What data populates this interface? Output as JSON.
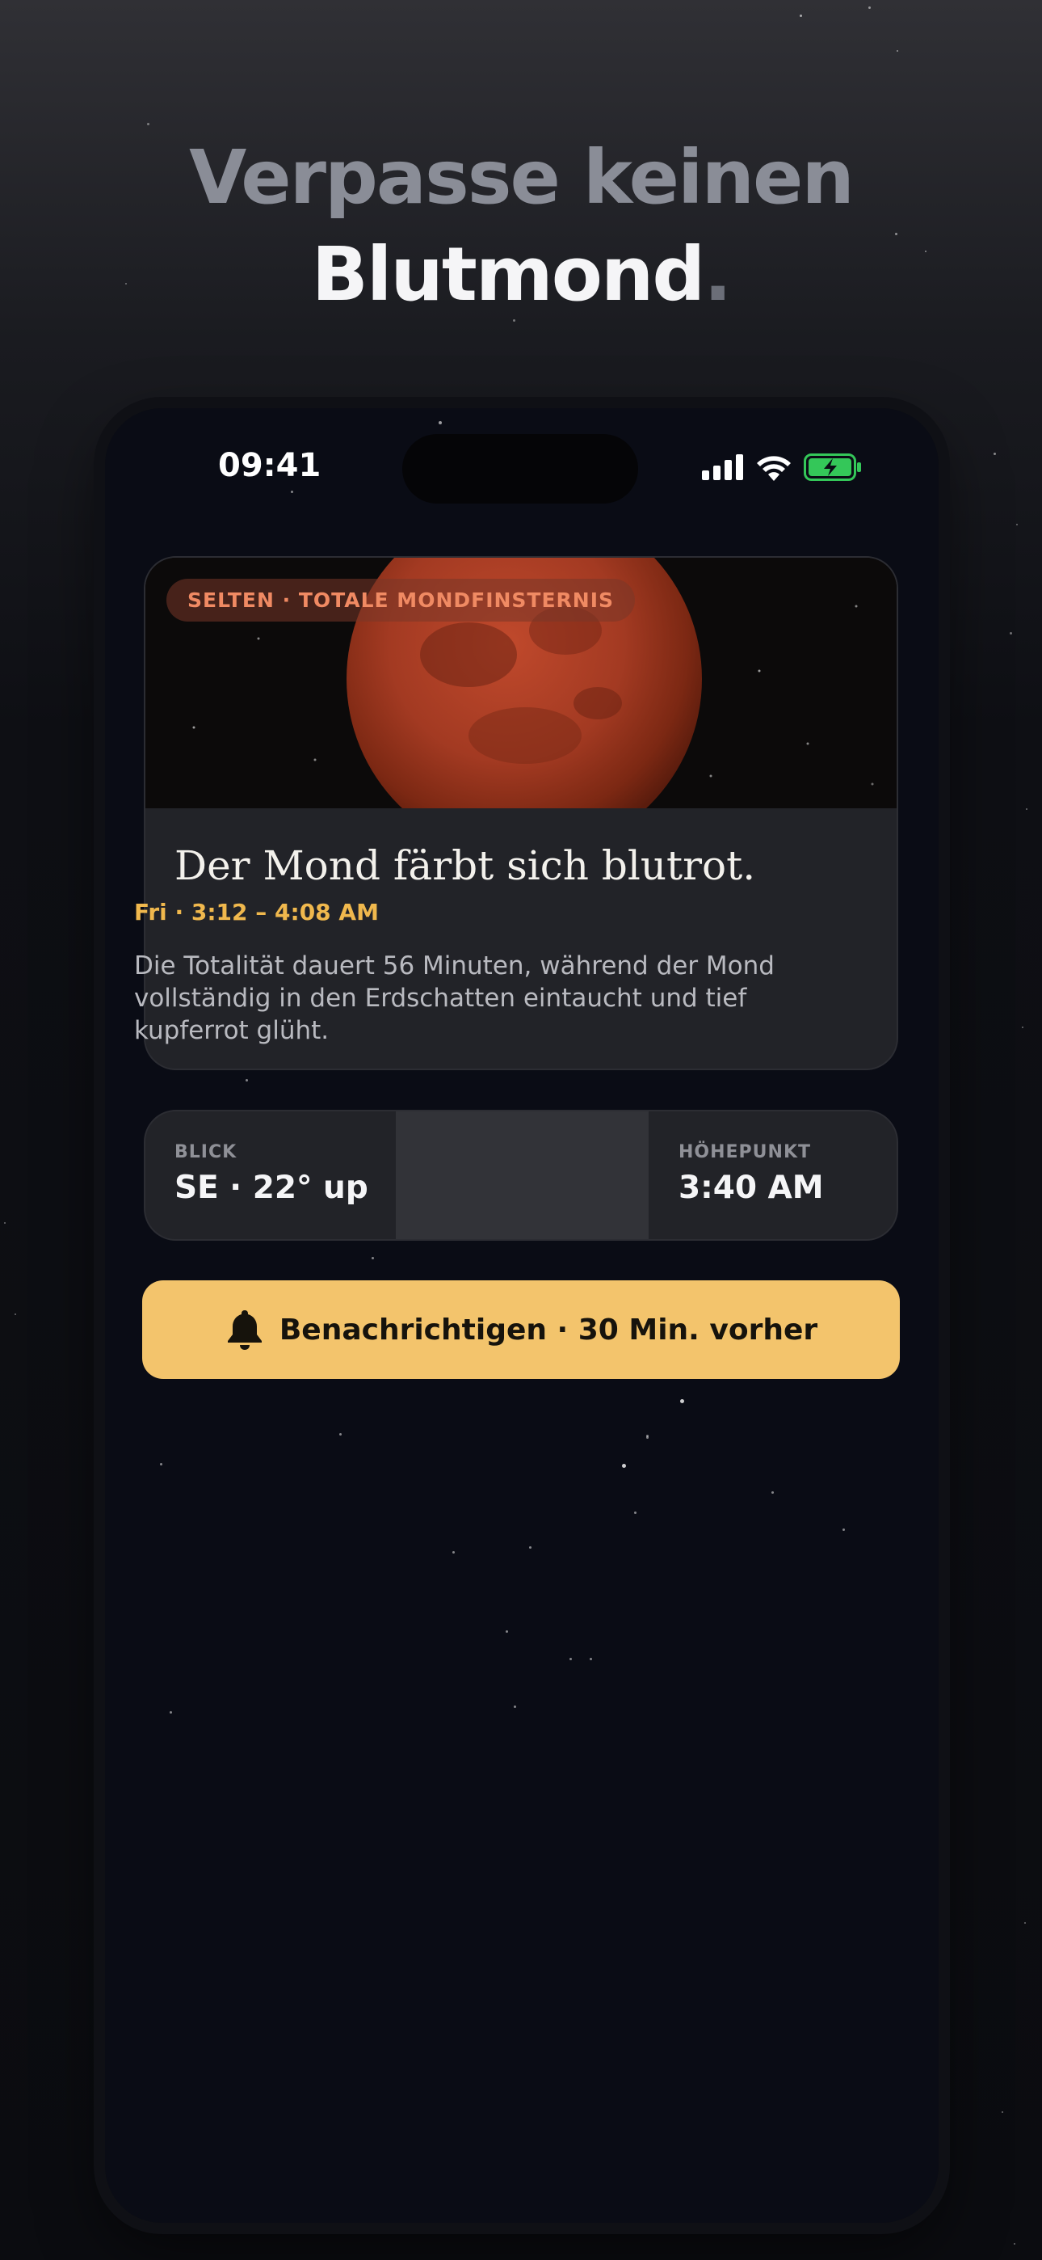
{
  "headline": {
    "line1": "Verpasse keinen",
    "line2": "Blutmond",
    "dot": "."
  },
  "status_bar": {
    "time": "09:41",
    "icons": [
      "signal-icon",
      "wifi-icon",
      "battery-charging-icon"
    ]
  },
  "event_card": {
    "badge": "SELTEN · TOTALE MONDFINSTERNIS",
    "title": "Der Mond färbt sich blutrot.",
    "time": "Fri · 3:12 – 4:08 AM",
    "description": "Die Totalität dauert 56 Minuten, während der Mond vollständig in den Erdschatten eintaucht und tief kupferrot glüht."
  },
  "info": {
    "look_label": "BLICK",
    "look_value": "SE · 22° up",
    "peak_label": "HÖHEPUNKT",
    "peak_value": "3:40 AM"
  },
  "notify_button": {
    "label": "Benachrichtigen · 30 Min. vorher",
    "icon": "bell-icon"
  },
  "colors": {
    "accent": "#f3c46c",
    "badge_text": "#f08a63",
    "time_text": "#f0b84d",
    "phone_bg": "#0a0c15",
    "card_bg": "#222328"
  }
}
